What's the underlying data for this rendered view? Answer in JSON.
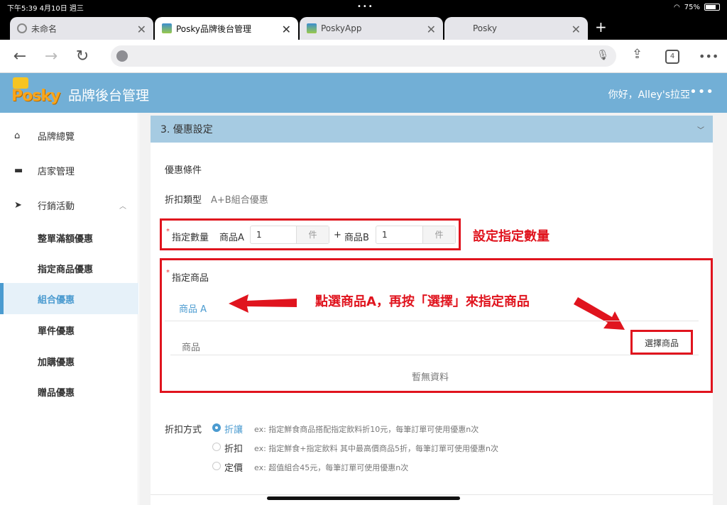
{
  "status": {
    "time": "下午5:39 4月10日 週三",
    "battery": "75%"
  },
  "tabs": [
    {
      "title": "未命名",
      "icon": "globe-icon"
    },
    {
      "title": "Posky品牌後台管理",
      "icon": "site-icon"
    },
    {
      "title": "PoskyApp",
      "icon": "site-icon"
    },
    {
      "title": "Posky",
      "icon": ""
    }
  ],
  "toolbar": {
    "tab_count": "4"
  },
  "header": {
    "logo_text": "Posky",
    "title": "品牌後台管理",
    "greeting": "你好，Alley's拉亞",
    "more": "•••"
  },
  "sidebar": {
    "items": [
      {
        "label": "品牌總覽",
        "icon": "home-icon"
      },
      {
        "label": "店家管理",
        "icon": "store-icon"
      },
      {
        "label": "行銷活動",
        "icon": "send-icon"
      },
      {
        "label": "整單滿額優惠"
      },
      {
        "label": "指定商品優惠"
      },
      {
        "label": "組合優惠"
      },
      {
        "label": "單件優惠"
      },
      {
        "label": "加購優惠"
      },
      {
        "label": "贈品優惠"
      }
    ]
  },
  "section": {
    "title": "3. 優惠設定",
    "condition_title": "優惠條件",
    "discount_type_label": "折扣類型",
    "discount_type_value": "A+B組合優惠",
    "qty_label": "指定數量",
    "product_a_label": "商品A",
    "product_a_qty": "1",
    "unit": "件",
    "plus": "+",
    "product_b_label": "商品B",
    "product_b_qty": "1",
    "assigned_label": "指定商品",
    "tab_a": "商品 A",
    "col_product": "商品",
    "select_button": "選擇商品",
    "empty": "暫無資料",
    "method_label": "折扣方式",
    "methods": [
      {
        "label": "折讓",
        "desc": "ex: 指定鮮食商品搭配指定飲料折10元，每筆訂單可使用優惠n次",
        "selected": true
      },
      {
        "label": "折扣",
        "desc": "ex: 指定鮮食+指定飲料 其中最高價商品5折，每筆訂單可使用優惠n次",
        "selected": false
      },
      {
        "label": "定價",
        "desc": "ex: 超值組合45元，每筆訂單可使用優惠n次",
        "selected": false
      }
    ]
  },
  "annotations": {
    "qty": "設定指定數量",
    "select": "點選商品A，再按「選擇」來指定商品"
  },
  "colors": {
    "accent": "#4b9bd0",
    "header": "#72afd6",
    "annotation": "#e0141e"
  }
}
